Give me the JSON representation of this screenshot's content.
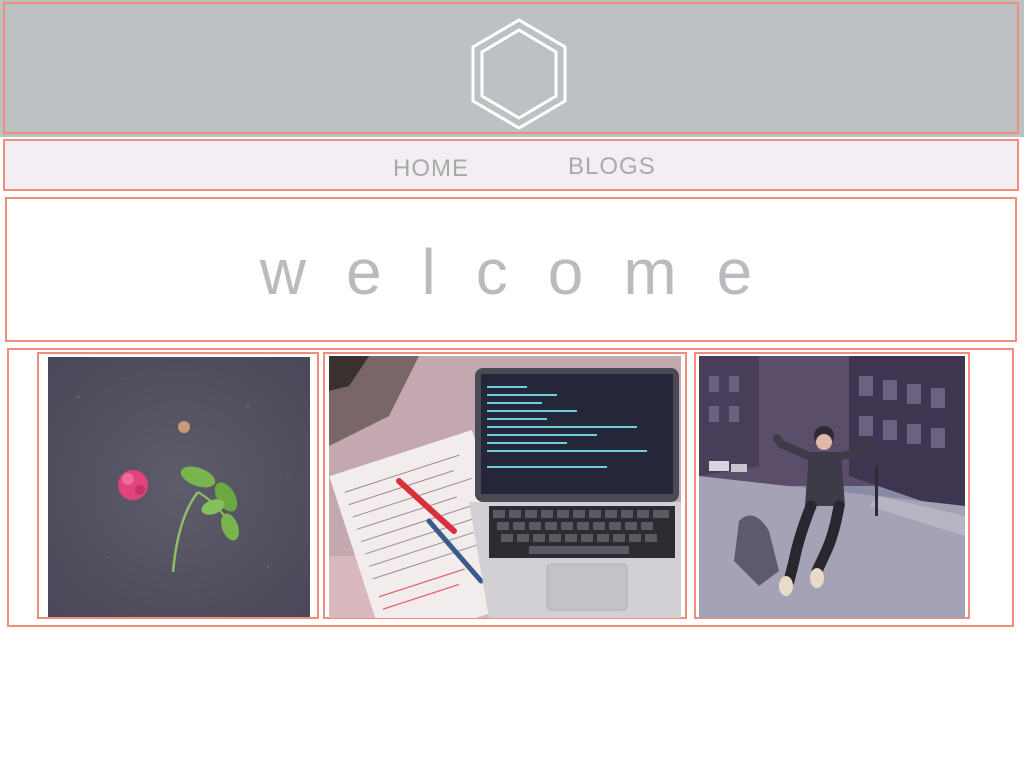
{
  "header": {
    "logo_icon": "hexagon-logo-icon"
  },
  "nav": {
    "items": [
      {
        "label": "HOME"
      },
      {
        "label": "BLOGS"
      }
    ]
  },
  "welcome": {
    "title": "welcome"
  },
  "gallery": {
    "photos": [
      {
        "icon": "photo-flowers-on-asphalt"
      },
      {
        "icon": "photo-laptop-and-notebook"
      },
      {
        "icon": "photo-person-jumping-street"
      }
    ]
  },
  "colors": {
    "header_bg": "#bcc2c4",
    "nav_bg": "#f3eef4",
    "outline": "#ef8e7c",
    "text_gray": "#a9a9a9"
  }
}
